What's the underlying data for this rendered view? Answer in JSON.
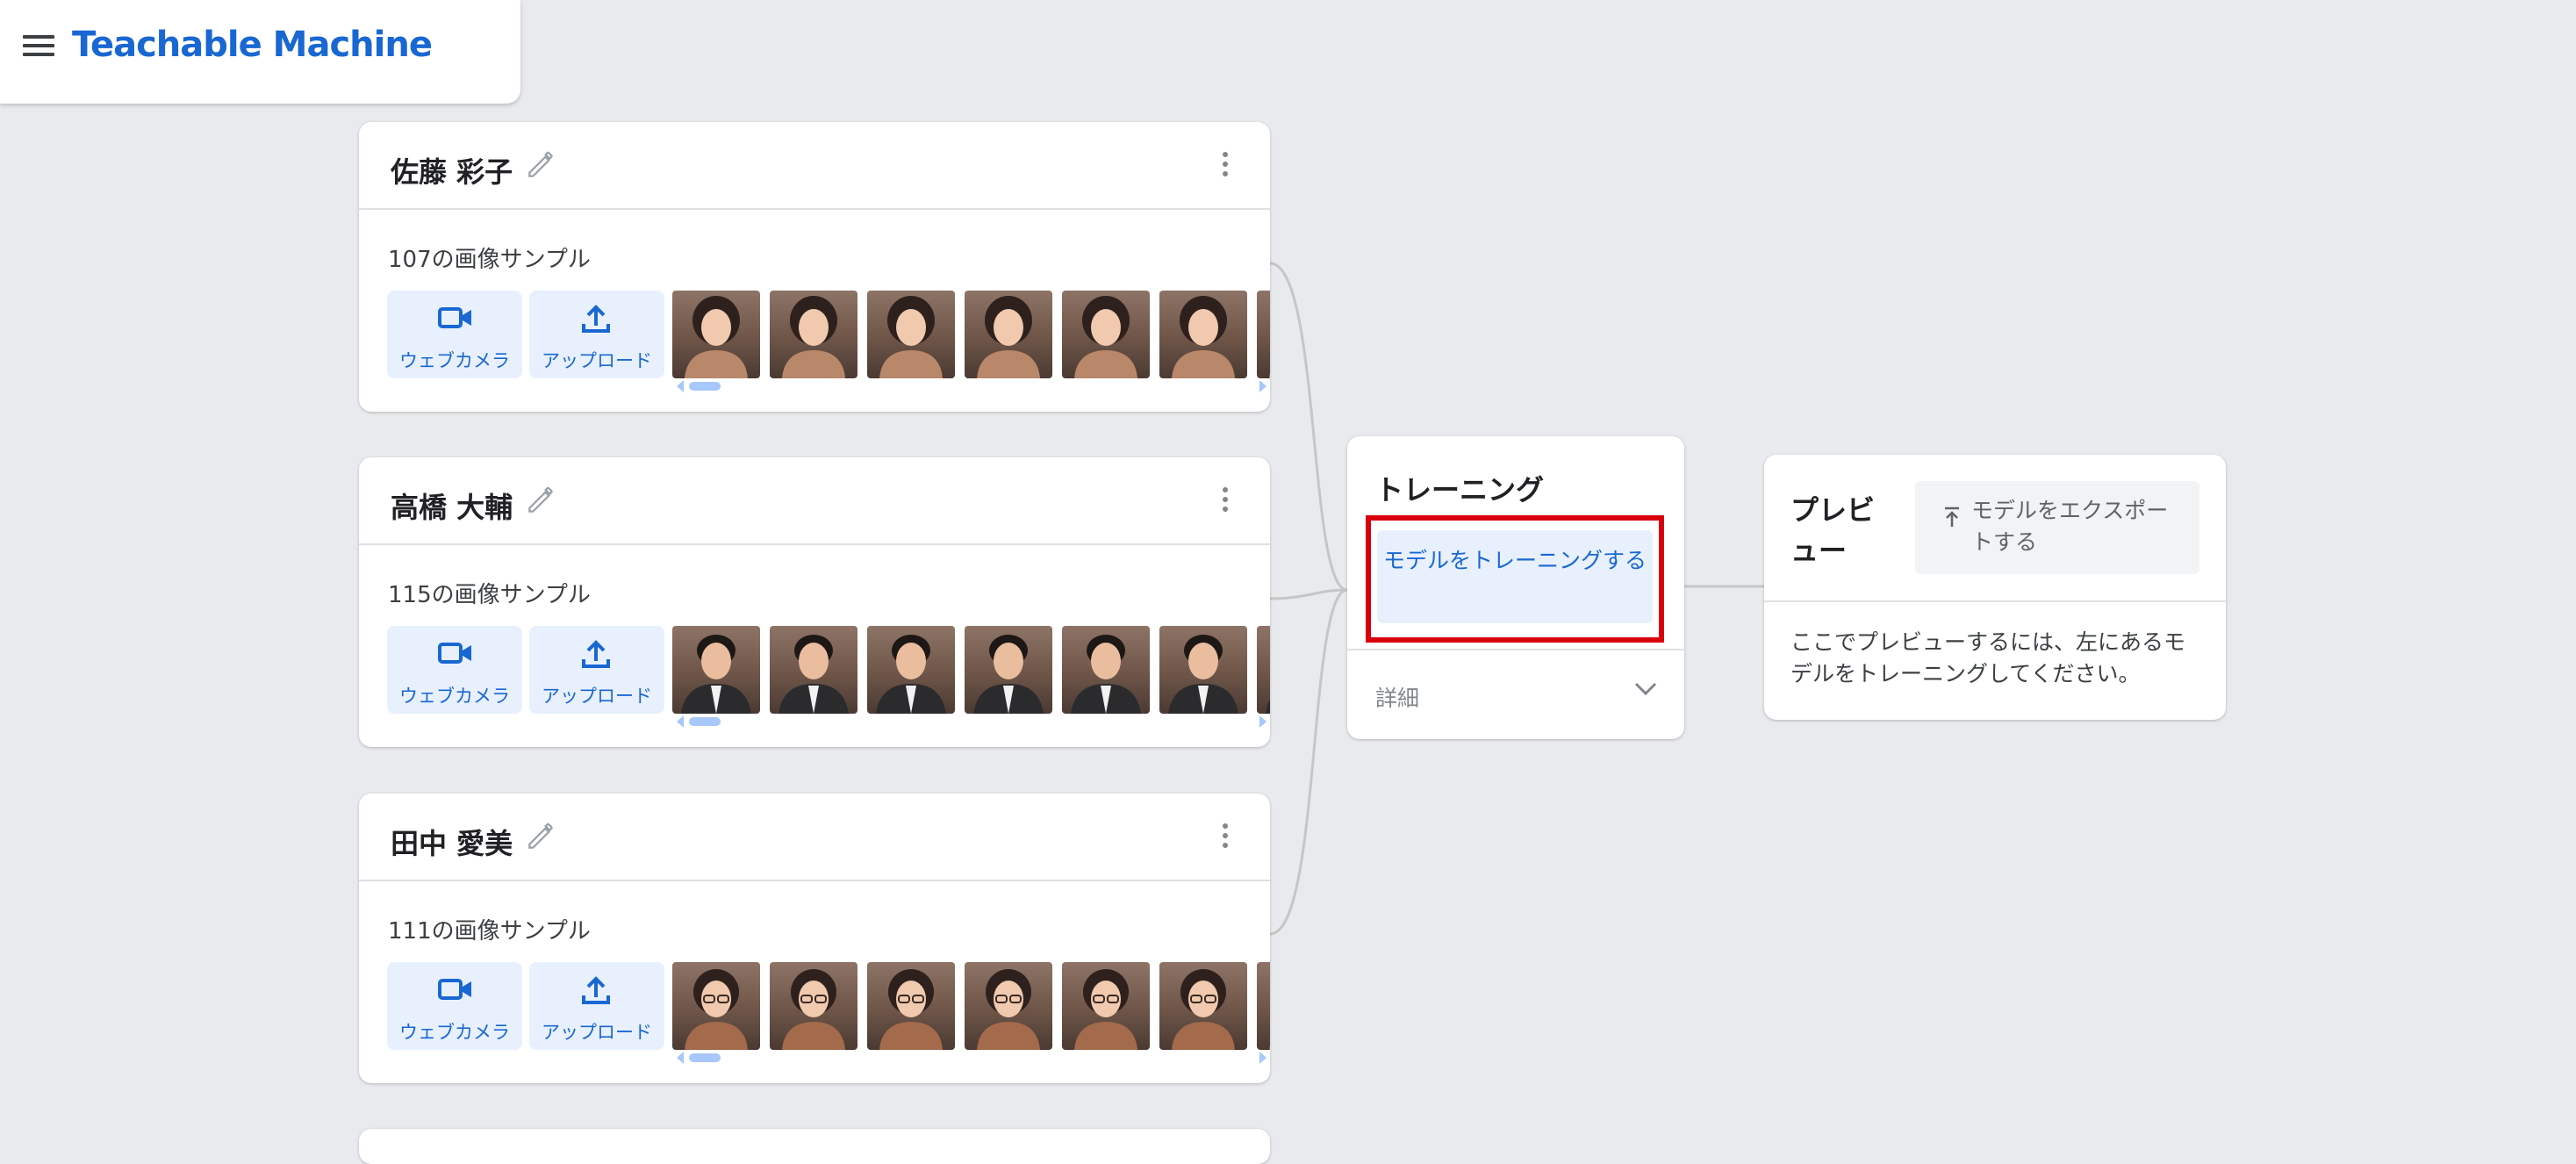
{
  "app": {
    "title": "Teachable Machine"
  },
  "classes": [
    {
      "name": "佐藤 彩子",
      "sample_count": "107の画像サンプル",
      "webcam_label": "ウェブカメラ",
      "upload_label": "アップロード",
      "thumb_tone": "#b9876a"
    },
    {
      "name": "高橋 大輔",
      "sample_count": "115の画像サンプル",
      "webcam_label": "ウェブカメラ",
      "upload_label": "アップロード",
      "thumb_tone": "#2b2b2e"
    },
    {
      "name": "田中 愛美",
      "sample_count": "111の画像サンプル",
      "webcam_label": "ウェブカメラ",
      "upload_label": "アップロード",
      "thumb_tone": "#a36a4c"
    }
  ],
  "training": {
    "title": "トレーニング",
    "train_button": "モデルをトレーニングする",
    "advanced": "詳細"
  },
  "preview": {
    "title": "プレビュー",
    "export_button": "モデルをエクスポートする",
    "message": "ここでプレビューするには、左にあるモデルをトレーニングしてください。"
  },
  "colors": {
    "accent": "#1967d2",
    "button_bg": "#e8f0fe",
    "highlight": "#d8000c",
    "background": "#e8eaed"
  }
}
